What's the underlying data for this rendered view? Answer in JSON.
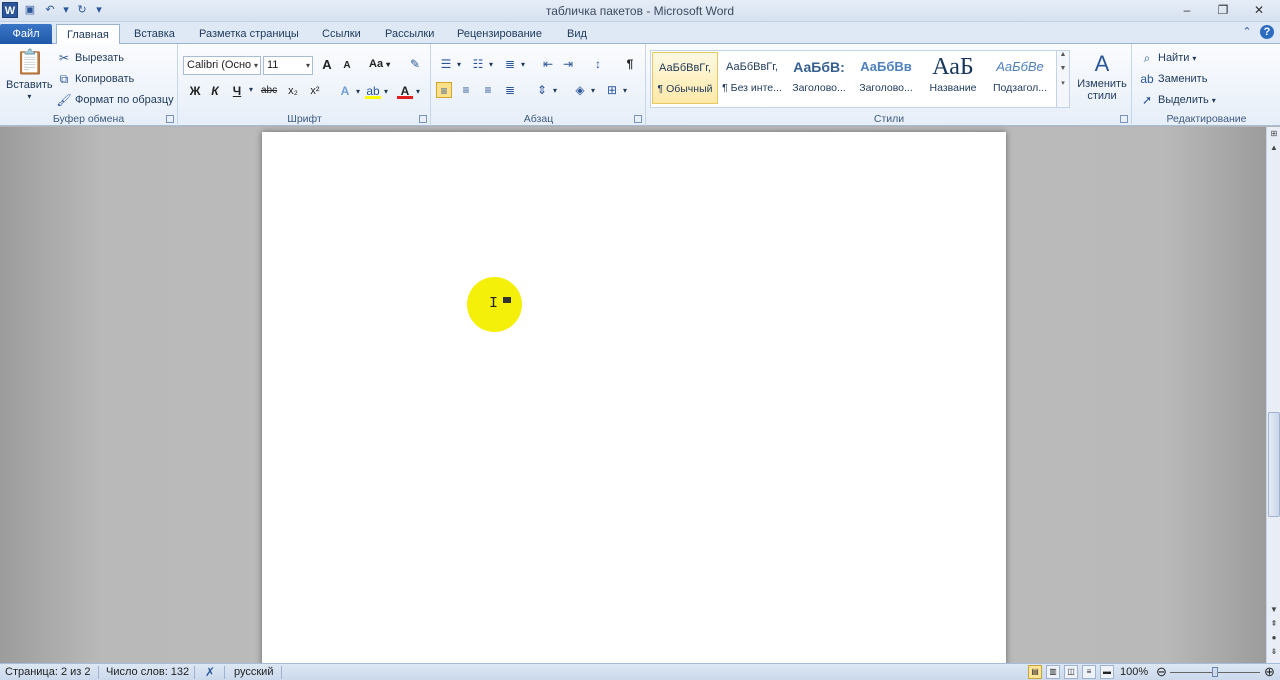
{
  "window": {
    "title": "табличка пакетов - Microsoft Word"
  },
  "qat": {
    "icons": [
      "word-icon",
      "save-icon",
      "undo-icon",
      "redo-icon",
      "customize-icon"
    ]
  },
  "tabs": [
    {
      "label": "Файл"
    },
    {
      "label": "Главная"
    },
    {
      "label": "Вставка"
    },
    {
      "label": "Разметка страницы"
    },
    {
      "label": "Ссылки"
    },
    {
      "label": "Рассылки"
    },
    {
      "label": "Рецензирование"
    },
    {
      "label": "Вид"
    }
  ],
  "clipboard": {
    "paste": "Вставить",
    "cut": "Вырезать",
    "copy": "Копировать",
    "format_painter": "Формат по образцу",
    "group": "Буфер обмена"
  },
  "font": {
    "name": "Calibri (Осно",
    "size": "11",
    "group": "Шрифт",
    "bold": "Ж",
    "italic": "К",
    "underline": "Ч",
    "strike": "abc",
    "sub": "x₂",
    "sup": "x²",
    "change_case": "Aa",
    "grow": "A",
    "shrink": "A"
  },
  "paragraph": {
    "group": "Абзац",
    "pilcrow": "¶"
  },
  "styles": {
    "group": "Стили",
    "items": [
      {
        "preview": "АаБбВвГг,",
        "name": "¶ Обычный"
      },
      {
        "preview": "АаБбВвГг,",
        "name": "¶ Без инте..."
      },
      {
        "preview": "АаБбВ:",
        "name": "Заголово..."
      },
      {
        "preview": "АаБбВв",
        "name": "Заголово..."
      },
      {
        "preview": "АаБ",
        "name": "Название"
      },
      {
        "preview": "АаБбВе",
        "name": "Подзагол..."
      }
    ],
    "change_styles": "Изменить стили"
  },
  "editing": {
    "group": "Редактирование",
    "find": "Найти",
    "replace": "Заменить",
    "select": "Выделить"
  },
  "status": {
    "page": "Страница: 2 из 2",
    "words": "Число слов: 132",
    "language": "русский",
    "zoom": "100%"
  }
}
